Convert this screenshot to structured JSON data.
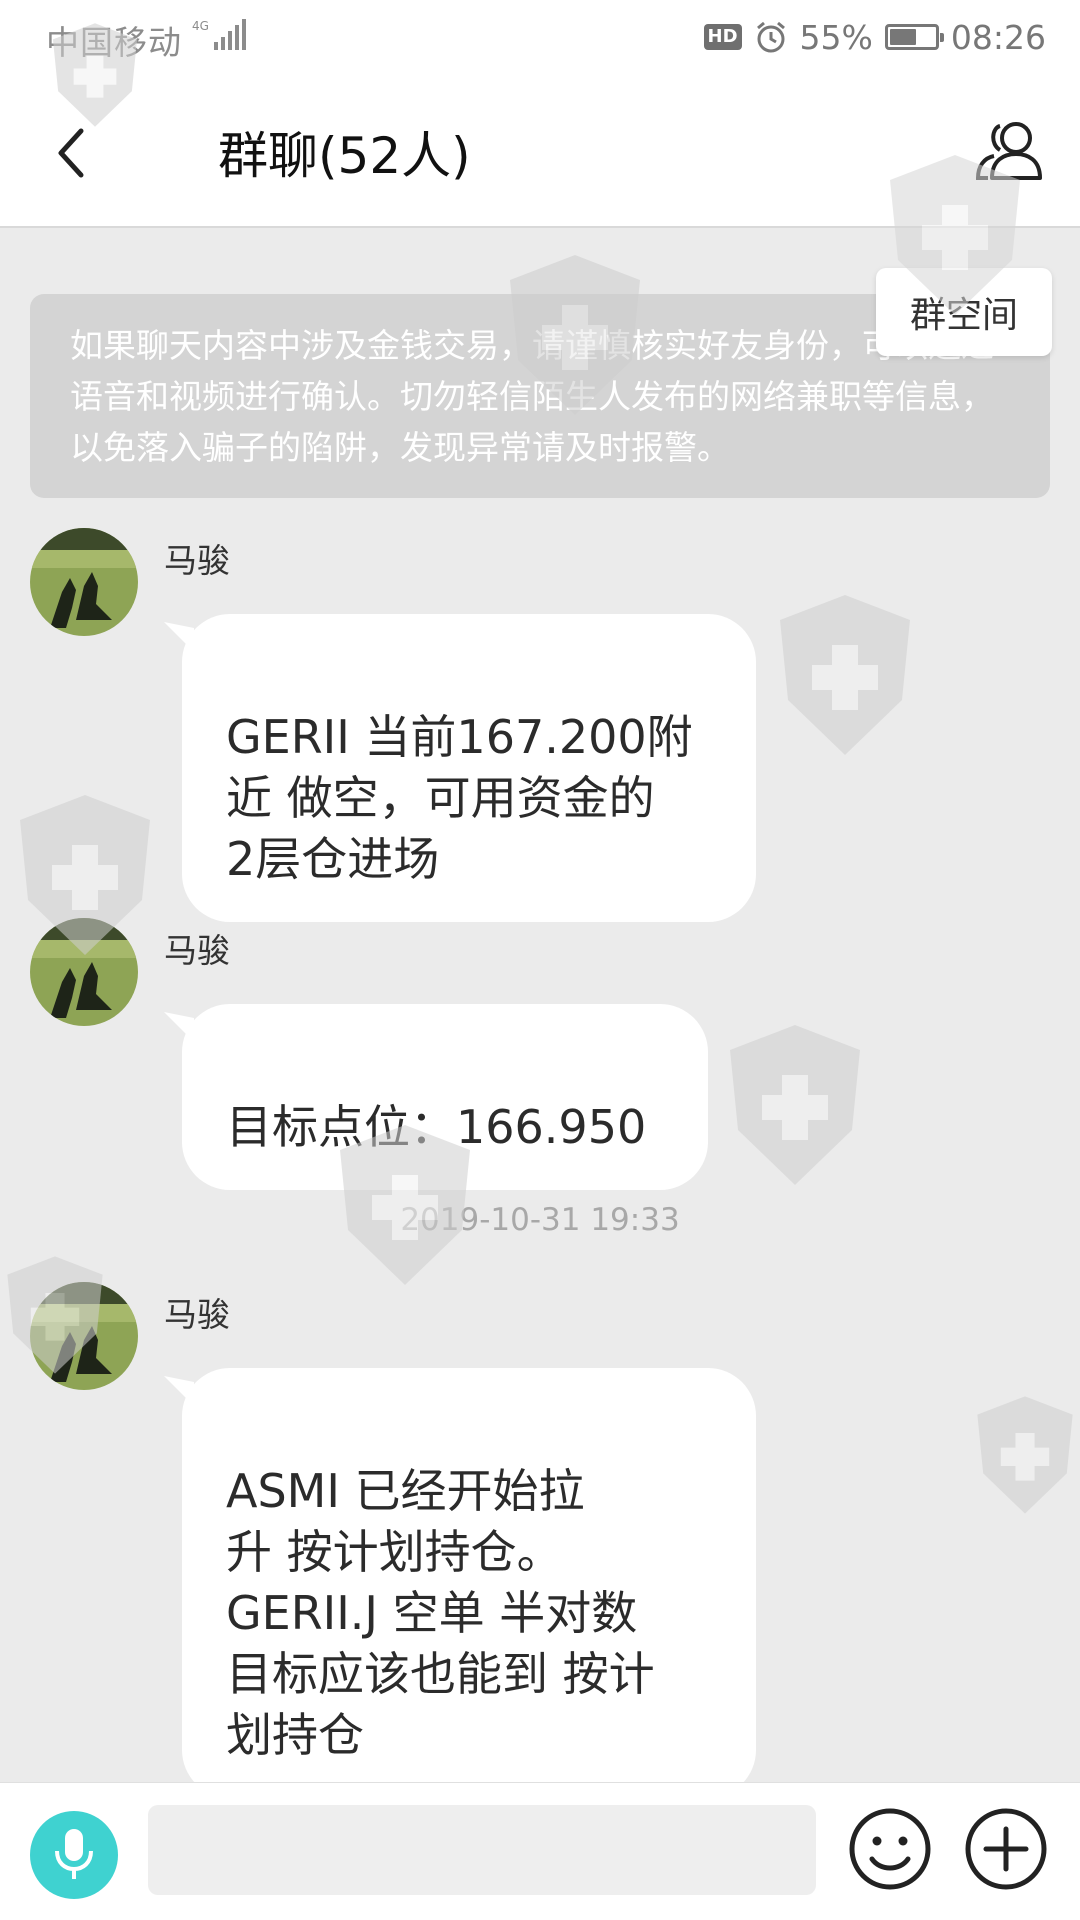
{
  "status_bar": {
    "carrier": "中国移动",
    "network": "4G",
    "hd": "HD",
    "battery": "55%",
    "battery_level": 0.55,
    "time": "08:26",
    "icons": [
      "signal-icon",
      "alarm-icon",
      "battery-icon"
    ]
  },
  "header": {
    "title": "群聊(52人)",
    "back_icon": "chevron-left-icon",
    "members_icon": "group-members-icon"
  },
  "group_space": {
    "label": "群空间"
  },
  "notice": {
    "text": "如果聊天内容中涉及金钱交易，请谨慎核实好友身份，可以通过语音和视频进行确认。切勿轻信陌生人发布的网络兼职等信息，以免落入骗子的陷阱，发现异常请及时报警。"
  },
  "messages": [
    {
      "sender": "马骏",
      "text": "GERII  当前167.200附\n近 做空，可用资金的\n2层仓进场"
    },
    {
      "sender": "马骏",
      "text": "目标点位：166.950"
    },
    {
      "sender": "马骏",
      "text": "ASMI  已经开始拉\n升 按计划持仓。\nGERII.J 空单 半对数\n目标应该也能到 按计\n划持仓"
    }
  ],
  "timestamp": "2019-10-31 19:33",
  "input_bar": {
    "placeholder": "",
    "mic_icon": "microphone-icon",
    "emoji_icon": "smiley-icon",
    "plus_icon": "plus-icon"
  }
}
